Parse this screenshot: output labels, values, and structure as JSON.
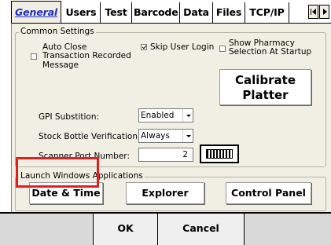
{
  "tabs": [
    {
      "label": "General",
      "active": true
    },
    {
      "label": "Users",
      "active": false
    },
    {
      "label": "Test",
      "active": false
    },
    {
      "label": "Barcode",
      "active": false
    },
    {
      "label": "Data",
      "active": false
    },
    {
      "label": "Files",
      "active": false
    },
    {
      "label": "TCP/IP",
      "active": false
    }
  ],
  "common_settings": {
    "legend": "Common Settings",
    "auto_close": {
      "line1": "Auto Close",
      "line2": "Transaction Recorded",
      "line3": "Message",
      "checked": false
    },
    "skip_user_login": {
      "label": "Skip User Login",
      "checked": true
    },
    "show_pharmacy": {
      "line1": "Show Pharmacy",
      "line2": "Selection At Startup",
      "checked": false
    },
    "calibrate": {
      "line1": "Calibrate",
      "line2": "Platter"
    },
    "gpi_substitution": {
      "label": "GPI Substition:",
      "value": "Enabled"
    },
    "stock_bottle": {
      "label": "Stock Bottle Verification:",
      "value": "Always"
    },
    "scanner_port": {
      "label": "Scanner Port Number:",
      "value": "2"
    },
    "keyboard_icon": "keyboard-icon"
  },
  "launch": {
    "legend": "Launch Windows Applications",
    "date_time": "Date & Time",
    "explorer": "Explorer",
    "control_panel": "Control Panel"
  },
  "footer": {
    "ok": "OK",
    "cancel": "Cancel"
  },
  "colors": {
    "active_tab": "#1f2fbf",
    "panel": "#f1efe3",
    "highlight": "#e02020",
    "footer": "#d9d9d9"
  }
}
